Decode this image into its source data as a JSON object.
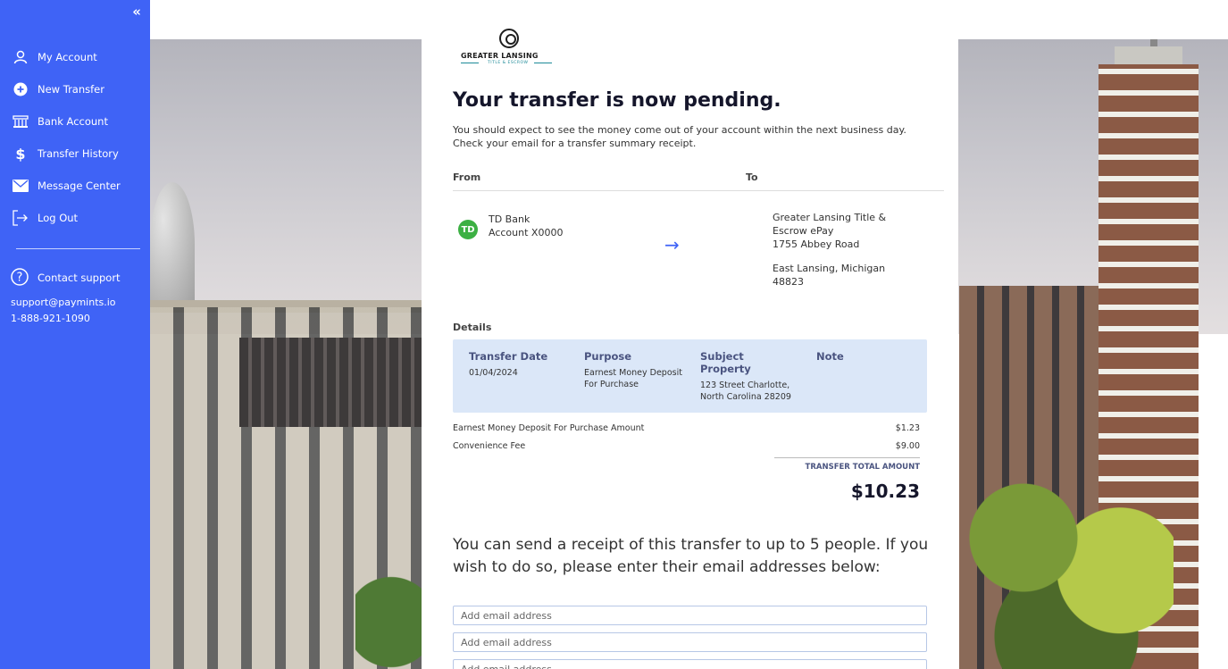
{
  "sidebar": {
    "collapse_icon": "double-chevron-left-icon",
    "items": [
      {
        "label": "My Account",
        "icon": "user-icon"
      },
      {
        "label": "New Transfer",
        "icon": "plus-circle-icon"
      },
      {
        "label": "Bank Account",
        "icon": "bank-icon"
      },
      {
        "label": "Transfer History",
        "icon": "dollar-icon"
      },
      {
        "label": "Message Center",
        "icon": "envelope-icon"
      },
      {
        "label": "Log Out",
        "icon": "logout-icon"
      }
    ],
    "support": {
      "label": "Contact support",
      "email": "support@paymints.io",
      "phone": "1-888-921-1090"
    }
  },
  "logo": {
    "name": "GREATER LANSING",
    "sub": "TITLE & ESCROW"
  },
  "main": {
    "title": "Your transfer is now pending.",
    "description": "You should expect to see the money come out of your account within the next business day. Check your email for a transfer summary receipt.",
    "from_label": "From",
    "to_label": "To",
    "from": {
      "bank_icon": "TD",
      "bank": "TD Bank",
      "account": "Account X0000"
    },
    "to": {
      "name": "Greater Lansing Title & Escrow ePay",
      "street": "1755 Abbey Road",
      "city": "East Lansing, Michigan 48823"
    },
    "details_label": "Details",
    "details": {
      "transfer_date_label": "Transfer Date",
      "transfer_date": "01/04/2024",
      "purpose_label": "Purpose",
      "purpose": "Earnest Money Deposit For Purchase",
      "property_label": "Subject Property",
      "property": "123 Street Charlotte, North Carolina 28209",
      "note_label": "Note",
      "note": ""
    },
    "fees": [
      {
        "label": "Earnest Money Deposit For Purchase Amount",
        "amount": "$1.23"
      },
      {
        "label": "Convenience Fee",
        "amount": "$9.00"
      }
    ],
    "total_label": "TRANSFER TOTAL AMOUNT",
    "total_amount": "$10.23",
    "receipt_text": "You can send a receipt of this transfer to up to 5 people. If you wish to do so, please enter their email addresses below:",
    "email_placeholder": "Add email address"
  }
}
